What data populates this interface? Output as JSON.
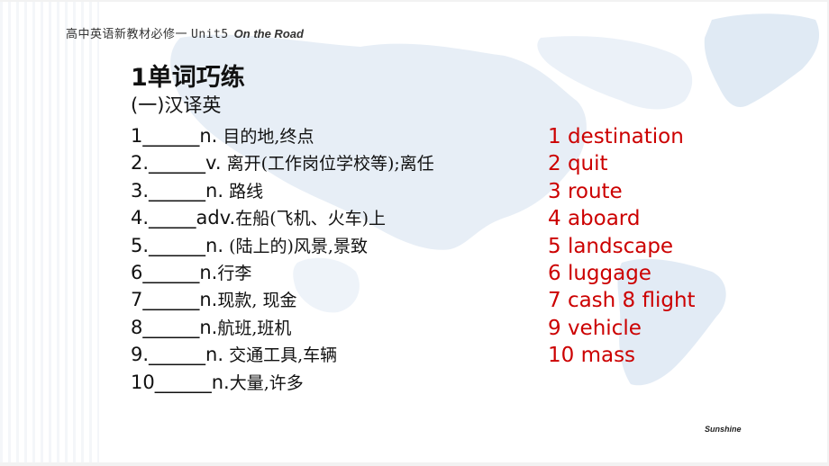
{
  "header": {
    "course": "高中英语新教材必修一",
    "unit": "Unit5",
    "title": "On the Road"
  },
  "section": {
    "title": "1单词巧练",
    "subtitle": "(一)汉译英"
  },
  "questions": [
    {
      "num": "1",
      "blank": "______",
      "pos": "n.",
      "meaning": " 目的地,终点"
    },
    {
      "num": "2.",
      "blank": "______",
      "pos": "v.",
      "meaning": " 离开(工作岗位学校等);离任"
    },
    {
      "num": "3.",
      "blank": "______",
      "pos": "n.",
      "meaning": " 路线"
    },
    {
      "num": "4.",
      "blank": "_____",
      "pos": "adv.",
      "meaning": "在船(飞机、火车)上"
    },
    {
      "num": "5.",
      "blank": "______",
      "pos": "n.",
      "meaning": " (陆上的)风景,景致"
    },
    {
      "num": "6",
      "blank": "______",
      "pos": "n.",
      "meaning": "行李"
    },
    {
      "num": "7",
      "blank": "______",
      "pos": "n.",
      "meaning": "现款, 现金"
    },
    {
      "num": "8",
      "blank": "______",
      "pos": "n.",
      "meaning": "航班,班机"
    },
    {
      "num": "9.",
      "blank": "______",
      "pos": "n.",
      "meaning": " 交通工具,车辆"
    },
    {
      "num": "10",
      "blank": "______",
      "pos": "n.",
      "meaning": "大量,许多"
    }
  ],
  "answers": [
    "1 destination",
    "2 quit",
    "3 route",
    "4 aboard",
    "5 landscape",
    "6 luggage",
    "7 cash  8 flight",
    "9 vehicle",
    "10 mass"
  ],
  "footer": {
    "brand": "Sunshine"
  },
  "colors": {
    "answer_red": "#cc0000",
    "text_black": "#111111",
    "map_blue": "#dbe6f2"
  }
}
